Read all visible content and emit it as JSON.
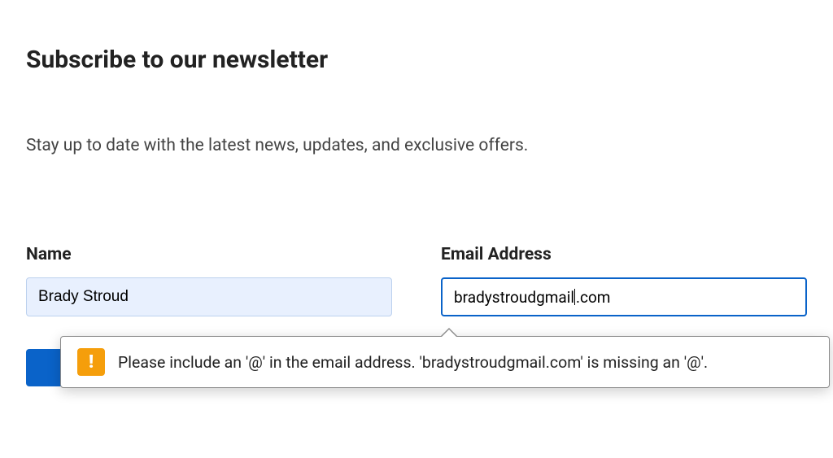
{
  "heading": "Subscribe to our newsletter",
  "subtitle": "Stay up to date with the latest news, updates, and exclusive offers.",
  "form": {
    "name": {
      "label": "Name",
      "value": "Brady Stroud"
    },
    "email": {
      "label": "Email Address",
      "value_before_caret": "bradystroudgmail",
      "value_after_caret": ".com"
    }
  },
  "validation": {
    "icon_glyph": "!",
    "message": "Please include an '@' in the email address. 'bradystroudgmail.com' is missing an '@'."
  }
}
